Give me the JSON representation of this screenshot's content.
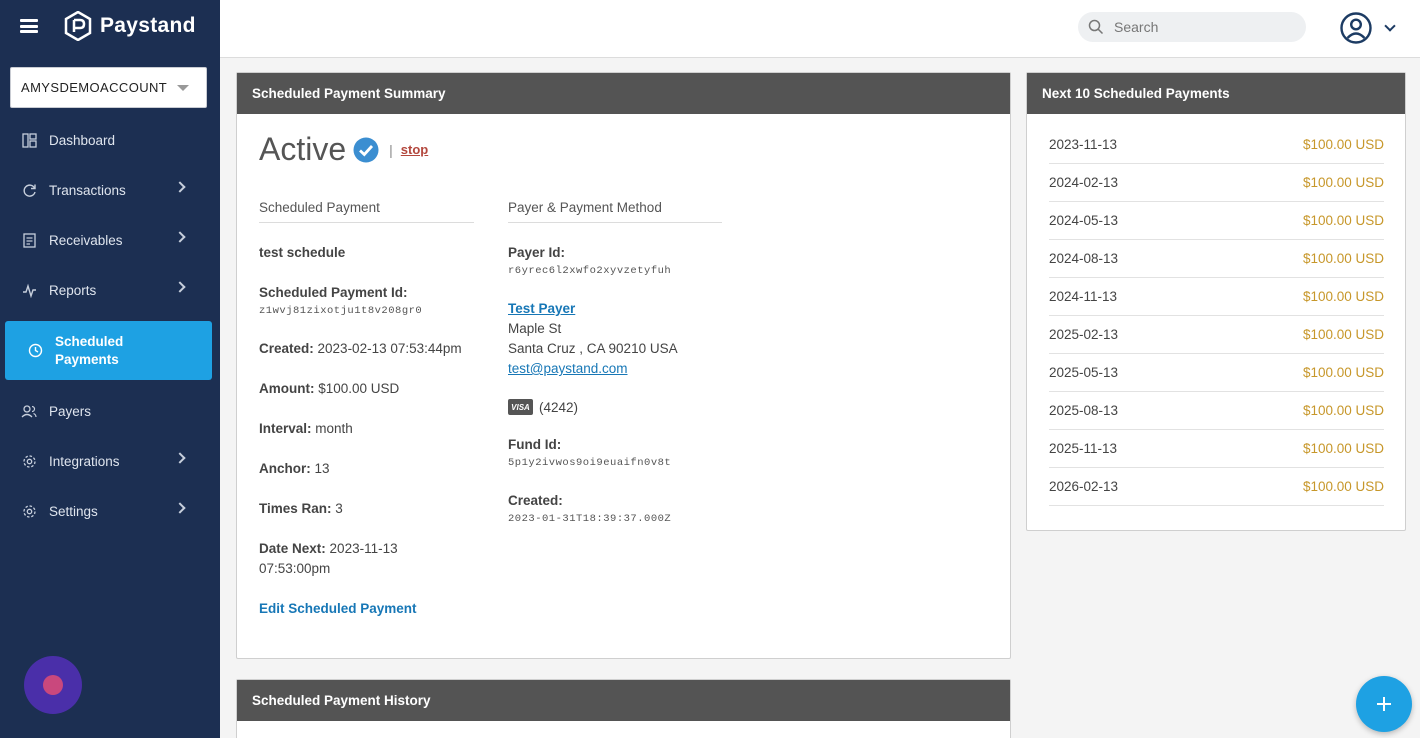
{
  "brand": {
    "name": "Paystand"
  },
  "account": {
    "name": "AMYSDEMOACCOUNT"
  },
  "nav": {
    "items": [
      {
        "label": "Dashboard",
        "icon": "dashboard-icon",
        "has_submenu": false
      },
      {
        "label": "Transactions",
        "icon": "refresh-icon",
        "has_submenu": true
      },
      {
        "label": "Receivables",
        "icon": "document-icon",
        "has_submenu": true
      },
      {
        "label": "Reports",
        "icon": "pulse-icon",
        "has_submenu": true
      },
      {
        "label": "Scheduled Payments",
        "icon": "clock-icon",
        "has_submenu": false,
        "active": true
      },
      {
        "label": "Payers",
        "icon": "users-icon",
        "has_submenu": false
      },
      {
        "label": "Integrations",
        "icon": "gear-icon",
        "has_submenu": true
      },
      {
        "label": "Settings",
        "icon": "gear-icon",
        "has_submenu": true
      }
    ]
  },
  "topbar": {
    "search_placeholder": "Search"
  },
  "summary": {
    "header": "Scheduled Payment Summary",
    "status": "Active",
    "stop_label": "stop",
    "left_column": {
      "title": "Scheduled Payment",
      "name": "test schedule",
      "id_label": "Scheduled Payment Id:",
      "id_value": "z1wvj81zixotju1t8v208gr0",
      "created_label": "Created:",
      "created_value": "2023-02-13 07:53:44pm",
      "amount_label": "Amount:",
      "amount_value": "$100.00 USD",
      "interval_label": "Interval:",
      "interval_value": "month",
      "anchor_label": "Anchor:",
      "anchor_value": "13",
      "times_ran_label": "Times Ran:",
      "times_ran_value": "3",
      "date_next_label": "Date Next:",
      "date_next_value": "2023-11-13 07:53:00pm",
      "edit_label": "Edit Scheduled Payment"
    },
    "right_column": {
      "title": "Payer & Payment Method",
      "payer_id_label": "Payer Id:",
      "payer_id_value": "r6yrec6l2xwfo2xyvzetyfuh",
      "payer_name": "Test Payer",
      "address_line1": "Maple St",
      "address_line2": "Santa Cruz , CA 90210 USA",
      "email": "test@paystand.com",
      "card_brand": "VISA",
      "card_last4": "(4242)",
      "fund_id_label": "Fund Id:",
      "fund_id_value": "5p1y2ivwos9oi9euaifn0v8t",
      "created_label": "Created:",
      "created_value": "2023-01-31T18:39:37.000Z"
    }
  },
  "next_payments": {
    "header": "Next 10 Scheduled Payments",
    "rows": [
      {
        "date": "2023-11-13",
        "amount": "$100.00 USD"
      },
      {
        "date": "2024-02-13",
        "amount": "$100.00 USD"
      },
      {
        "date": "2024-05-13",
        "amount": "$100.00 USD"
      },
      {
        "date": "2024-08-13",
        "amount": "$100.00 USD"
      },
      {
        "date": "2024-11-13",
        "amount": "$100.00 USD"
      },
      {
        "date": "2025-02-13",
        "amount": "$100.00 USD"
      },
      {
        "date": "2025-05-13",
        "amount": "$100.00 USD"
      },
      {
        "date": "2025-08-13",
        "amount": "$100.00 USD"
      },
      {
        "date": "2025-11-13",
        "amount": "$100.00 USD"
      },
      {
        "date": "2026-02-13",
        "amount": "$100.00 USD"
      }
    ]
  },
  "history": {
    "header": "Scheduled Payment History"
  },
  "colors": {
    "sidebar_bg": "#1c2f52",
    "active_nav": "#1ea1e3",
    "panel_header": "#545454",
    "amount_gold": "#c7972a",
    "link_blue": "#1777b6",
    "stop_red": "#b3473d",
    "chat_purple": "#4a2fa9"
  }
}
